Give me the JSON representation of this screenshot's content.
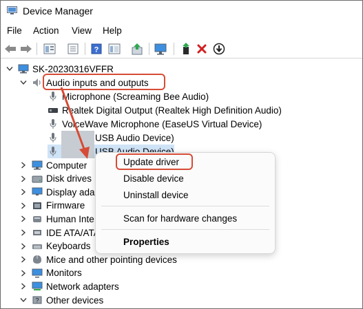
{
  "window": {
    "title": "Device Manager"
  },
  "menu": [
    "File",
    "Action",
    "View",
    "Help"
  ],
  "toolbar": {
    "buttons": [
      "back-icon",
      "forward-icon",
      "properties-icon",
      "list-view-icon",
      "help-icon",
      "tree-view-icon",
      "update-driver-icon",
      "monitor-icon",
      "enable-device-icon",
      "uninstall-icon",
      "disable-icon"
    ]
  },
  "tree": {
    "root": "SK-20230316VFFR",
    "audio_category": "Audio inputs and outputs",
    "audio_children": [
      "Microphone (Screaming Bee Audio)",
      "Realtek Digital Output (Realtek High Definition Audio)",
      "VoiceWave Microphone (EaseUS Virtual Device)",
      "USB Audio Device)",
      "USB Audio Device)"
    ],
    "categories": [
      "Computer",
      "Disk drives",
      "Display ada",
      "Firmware",
      "Human Inte",
      "IDE ATA/ATA",
      "Keyboards",
      "Mice and other pointing devices",
      "Monitors",
      "Network adapters",
      "Other devices"
    ]
  },
  "context_menu": {
    "items": [
      "Update driver",
      "Disable device",
      "Uninstall device",
      "Scan for hardware changes",
      "Properties"
    ]
  },
  "colors": {
    "annotation": "#d64b35"
  }
}
